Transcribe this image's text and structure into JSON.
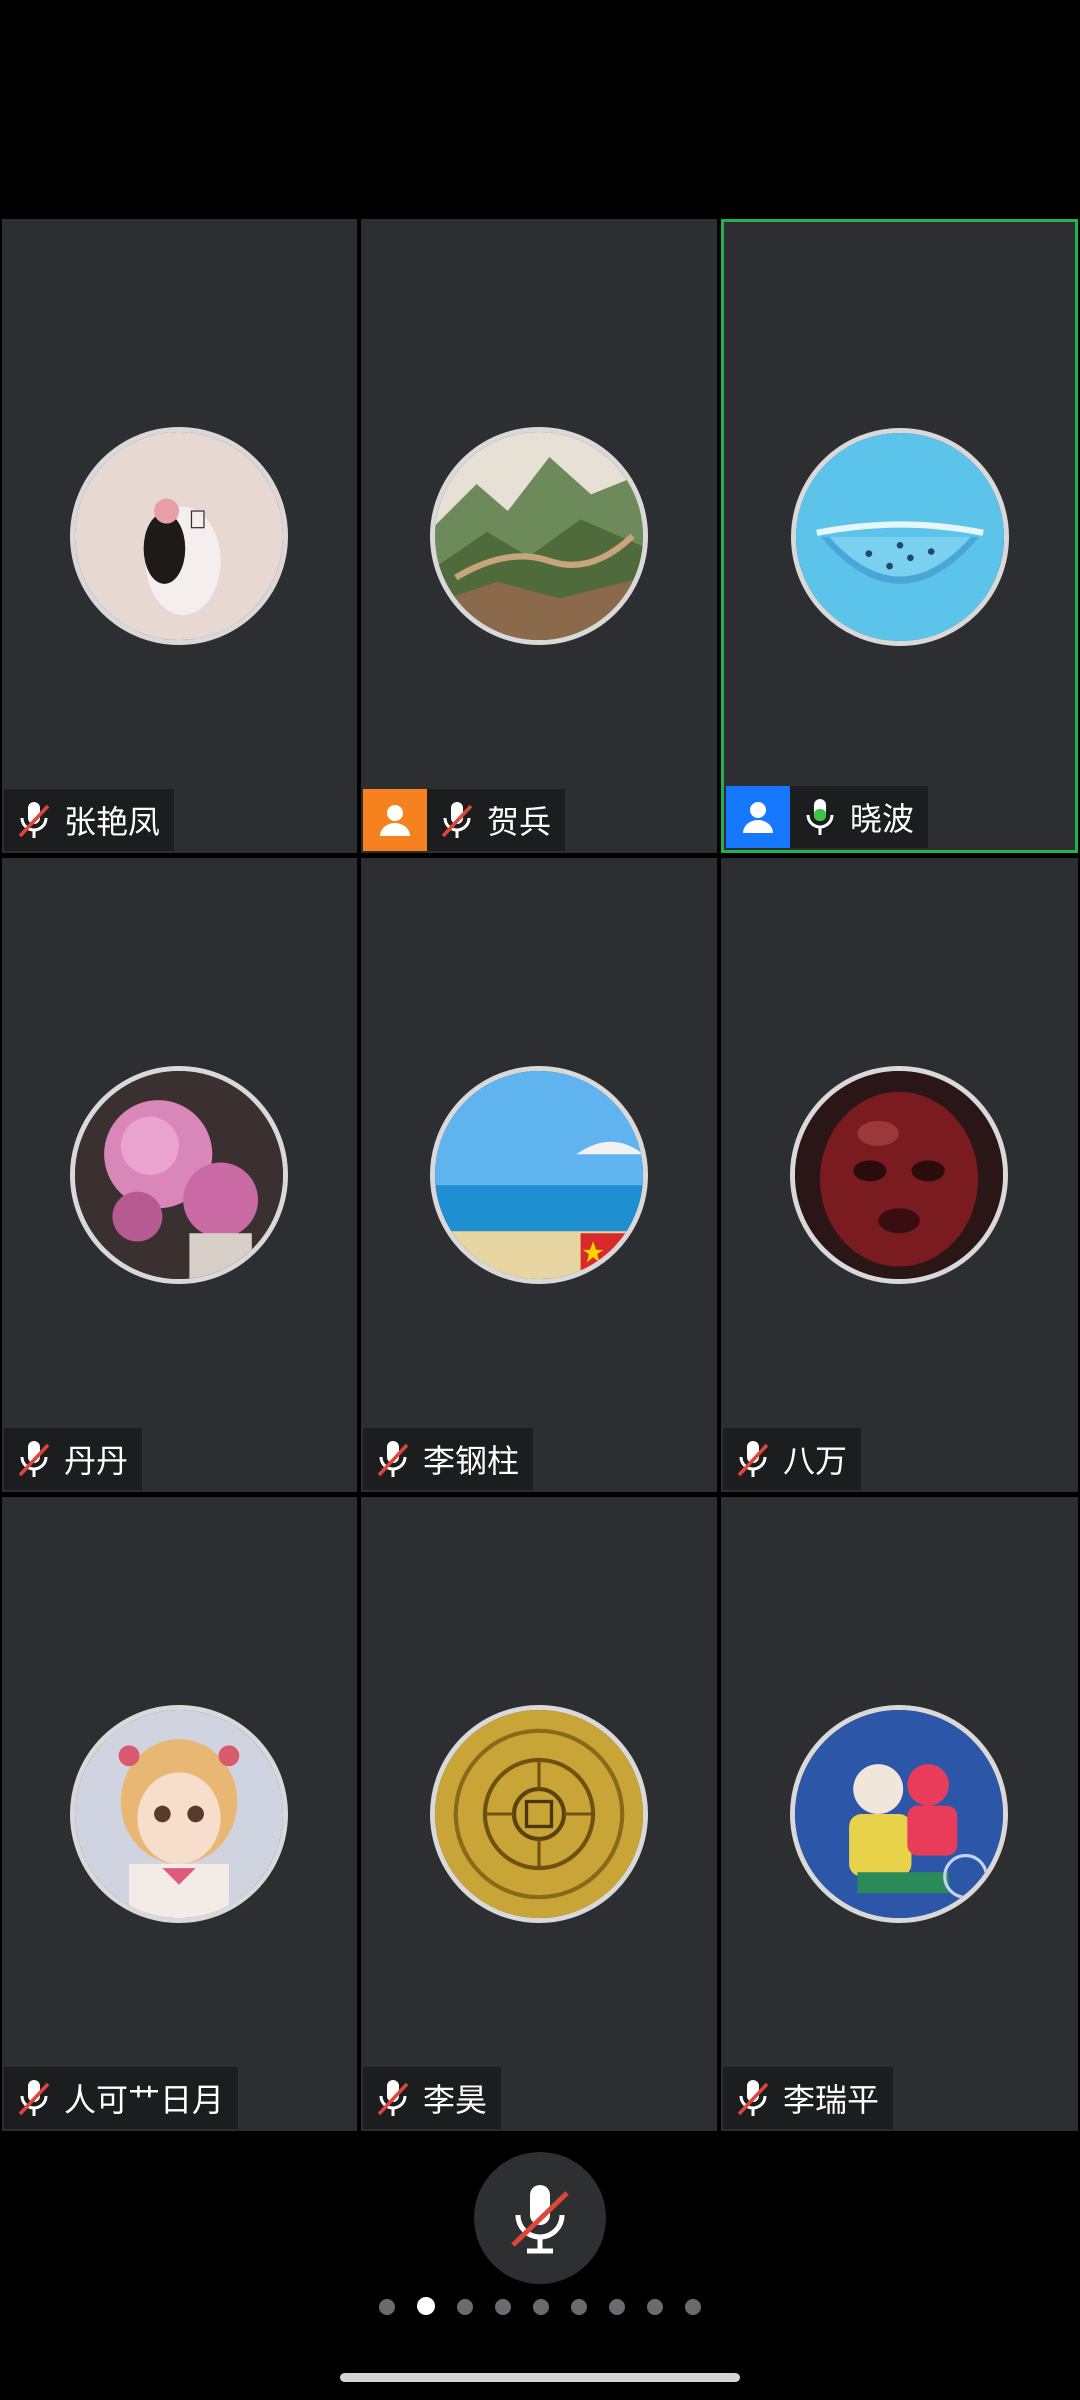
{
  "participants": [
    {
      "name": "张艳凤",
      "mic": "muted",
      "badge": null,
      "avatar": "girl-illustration"
    },
    {
      "name": "贺兵",
      "mic": "muted",
      "badge": "host",
      "avatar": "great-wall-painting"
    },
    {
      "name": "晓波",
      "mic": "active",
      "badge": "cohost",
      "avatar": "watermelon",
      "speaking": true
    },
    {
      "name": "丹丹",
      "mic": "muted",
      "badge": null,
      "avatar": "peony-flowers"
    },
    {
      "name": "李钢柱",
      "mic": "muted",
      "badge": null,
      "avatar": "beach-sea"
    },
    {
      "name": "八万",
      "mic": "muted",
      "badge": null,
      "avatar": "red-statue-face"
    },
    {
      "name": "人可艹日月",
      "mic": "muted",
      "badge": null,
      "avatar": "doll-girl"
    },
    {
      "name": "李昊",
      "mic": "muted",
      "badge": null,
      "avatar": "golden-bagua-plate"
    },
    {
      "name": "李瑞平",
      "mic": "muted",
      "badge": null,
      "avatar": "folk-art-grandma"
    }
  ],
  "controls": {
    "mic_button": "mic-muted-icon"
  },
  "pagination": {
    "total": 9,
    "current": 2
  },
  "colors": {
    "tile_bg": "#2c2e31",
    "active_border": "#25b04e",
    "host_badge": "#f5821f",
    "cohost_badge": "#1677ff",
    "mute_slash": "#e0453a",
    "mic_active": "#3bc34a"
  }
}
